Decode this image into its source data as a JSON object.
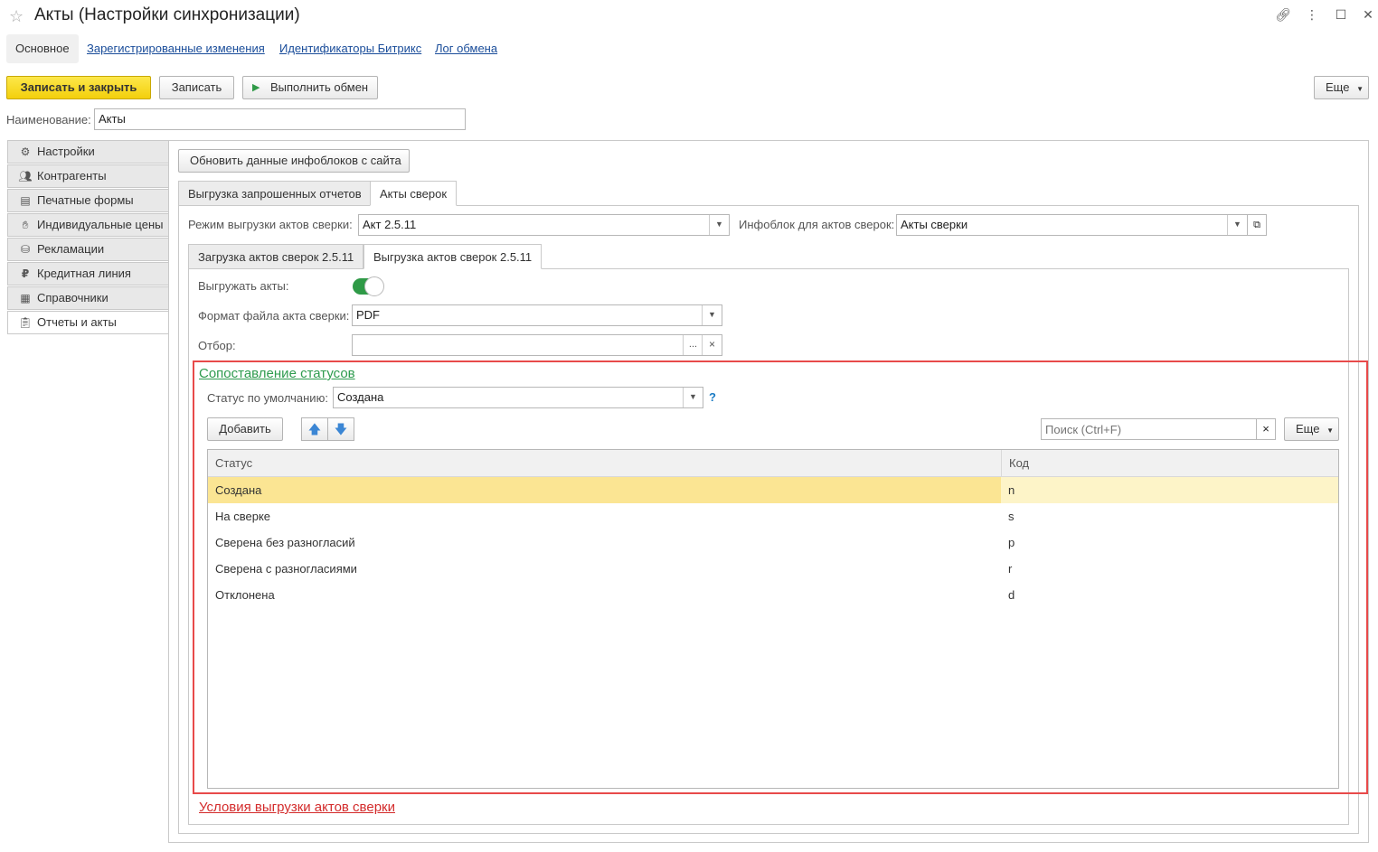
{
  "window": {
    "title": "Акты (Настройки синхронизации)"
  },
  "nav_tabs": [
    "Основное",
    "Зарегистрированные изменения",
    "Идентификаторы Битрикс",
    "Лог обмена"
  ],
  "toolbar": {
    "save_close": "Записать и закрыть",
    "save": "Записать",
    "run_exchange": "Выполнить обмен",
    "more": "Еще"
  },
  "name_field": {
    "label": "Наименование:",
    "value": "Акты"
  },
  "sidebar": {
    "items": [
      {
        "label": "Настройки",
        "icon": "gear-icon"
      },
      {
        "label": "Контрагенты",
        "icon": "users-icon"
      },
      {
        "label": "Печатные формы",
        "icon": "document-icon"
      },
      {
        "label": "Индивидуальные цены",
        "icon": "handshake-icon"
      },
      {
        "label": "Рекламации",
        "icon": "bag-icon"
      },
      {
        "label": "Кредитная линия",
        "icon": "ruble-icon"
      },
      {
        "label": "Справочники",
        "icon": "table-icon"
      },
      {
        "label": "Отчеты и акты",
        "icon": "clipboard-icon"
      }
    ]
  },
  "main": {
    "refresh_button": "Обновить данные инфоблоков с сайта",
    "tabs": [
      "Выгрузка запрошенных отчетов",
      "Акты сверок"
    ],
    "export_mode_label": "Режим выгрузки актов сверки:",
    "export_mode_value": "Акт 2.5.11",
    "infoblock_label": "Инфоблок для актов сверок:",
    "infoblock_value": "Акты сверки",
    "subtabs": [
      "Загрузка актов сверок 2.5.11",
      "Выгрузка актов сверок 2.5.11"
    ],
    "export_acts_label": "Выгружать акты:",
    "format_label": "Формат файла акта сверки:",
    "format_value": "PDF",
    "filter_label": "Отбор:",
    "filter_value": "",
    "filter_dots": "...",
    "clear_symbol": "×",
    "status_mapping_title": "Сопоставление статусов",
    "default_status_label": "Статус по умолчанию:",
    "default_status_value": "Создана",
    "help_symbol": "?",
    "add_button": "Добавить",
    "search_placeholder": "Поиск (Ctrl+F)",
    "more_button": "Еще",
    "table": {
      "headers": [
        "Статус",
        "Код"
      ],
      "rows": [
        [
          "Создана",
          "n"
        ],
        [
          "На сверке",
          "s"
        ],
        [
          "Сверена без разногласий",
          "p"
        ],
        [
          "Сверена с разногласиями",
          "r"
        ],
        [
          "Отклонена",
          "d"
        ]
      ]
    },
    "export_conditions_link": "Условия выгрузки актов сверки"
  },
  "colors": {
    "accent_yellow": "#f5d31a",
    "toggle_green": "#2f9a47",
    "selected_row": "#fbe593",
    "highlight_frame": "#e84a4a",
    "link_green": "#2e9b4e",
    "link_red": "#d32b2b",
    "link_blue": "#1a4d9a"
  }
}
